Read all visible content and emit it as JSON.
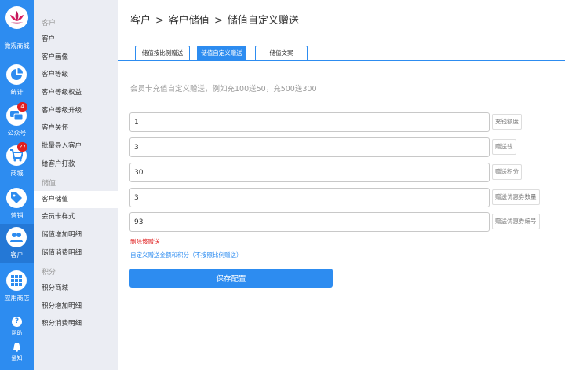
{
  "colors": {
    "primary": "#2d8cf0",
    "sidebar_bg": "#ebedf3",
    "danger": "#e02020"
  },
  "rail": {
    "logo_label": "微观商城",
    "items": [
      {
        "label": "统计",
        "icon": "pie-chart-icon"
      },
      {
        "label": "公众号",
        "icon": "chat-icon",
        "badge": "4"
      },
      {
        "label": "商城",
        "icon": "cart-icon",
        "badge": "27"
      },
      {
        "label": "营销",
        "icon": "tag-icon"
      },
      {
        "label": "客户",
        "icon": "users-icon"
      },
      {
        "label": "应用商店",
        "icon": "grid-icon"
      }
    ],
    "help_label": "帮助",
    "notify_label": "通知"
  },
  "side": {
    "sections": [
      {
        "title": "客户",
        "items": [
          "客户",
          "客户画像",
          "客户等级",
          "客户等级权益",
          "客户等级升级",
          "客户关怀",
          "批量导入客户",
          "给客户打款"
        ]
      },
      {
        "title": "储值",
        "items": [
          "客户储值",
          "会员卡样式",
          "储值增加明细",
          "储值消费明细"
        ]
      },
      {
        "title": "积分",
        "items": [
          "积分商城",
          "积分增加明细",
          "积分消费明细"
        ]
      }
    ],
    "active_item": "客户储值"
  },
  "breadcrumb": [
    "客户",
    ">",
    "客户储值",
    ">",
    "储值自定义赠送"
  ],
  "tabs": [
    "储值按比例赠送",
    "储值自定义赠送",
    "储值文案"
  ],
  "active_tab": "储值自定义赠送",
  "description": "会员卡充值自定义赠送，例如充100送50，充500送300",
  "fields": [
    {
      "value": "1",
      "label": "充钱额度"
    },
    {
      "value": "3",
      "label": "赠送钱"
    },
    {
      "value": "30",
      "label": "赠送积分"
    },
    {
      "value": "3",
      "label": "赠送优惠券数量"
    },
    {
      "value": "93",
      "label": "赠送优惠券编号"
    }
  ],
  "delete_link": "删除该赠送",
  "custom_note": "自定义赠送金额和积分（不按照比例赠送）",
  "save_button": "保存配置"
}
